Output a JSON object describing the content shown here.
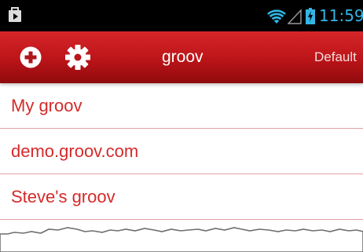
{
  "status_bar": {
    "time": "11:59",
    "icons": [
      "notification-icon",
      "wifi-icon",
      "cell-signal-icon",
      "battery-charging-icon"
    ],
    "time_color": "#33b5e5"
  },
  "action_bar": {
    "title": "groov",
    "default_label": "Default",
    "icons": [
      "add-icon",
      "settings-gear-icon"
    ],
    "brand_color": "#c0181c"
  },
  "servers": [
    {
      "label": "My groov"
    },
    {
      "label": "demo.groov.com"
    },
    {
      "label": "Steve's groov"
    }
  ],
  "colors": {
    "item_text": "#d42a2a",
    "divider": "#e3a0a0"
  }
}
